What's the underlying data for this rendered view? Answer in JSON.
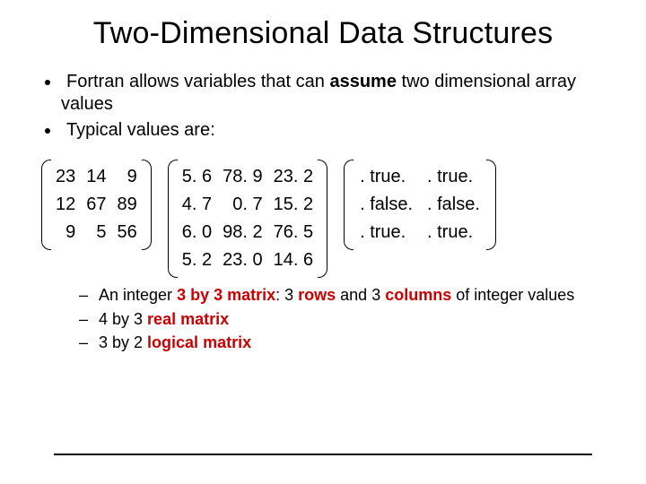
{
  "title": "Two-Dimensional Data Structures",
  "bullet1_a": "Fortran allows variables that can ",
  "bullet1_b": "assume",
  "bullet1_c": " two dimensional array values",
  "bullet2": "Typical values are:",
  "matrices": {
    "int": [
      [
        "23",
        "14",
        "9"
      ],
      [
        "12",
        "67",
        "89"
      ],
      [
        "9",
        "5",
        "56"
      ]
    ],
    "real": [
      [
        "5. 6",
        "78. 9",
        "23. 2"
      ],
      [
        "4. 7",
        "0. 7",
        "15. 2"
      ],
      [
        "6. 0",
        "98. 2",
        "76. 5"
      ],
      [
        "5. 2",
        "23. 0",
        "14. 6"
      ]
    ],
    "logical": [
      [
        ". true.",
        ". true."
      ],
      [
        ". false.",
        ". false."
      ],
      [
        ". true.",
        ". true."
      ]
    ]
  },
  "sub1_a": "An integer ",
  "sub1_b": "3 by 3 matrix",
  "sub1_c": ": 3 ",
  "sub1_d": "rows",
  "sub1_e": " and 3 ",
  "sub1_f": "columns",
  "sub1_g": " of integer values",
  "sub2_a": "4 by 3 ",
  "sub2_b": "real matrix",
  "sub3_a": "3 by 2 ",
  "sub3_b": "logical matrix"
}
